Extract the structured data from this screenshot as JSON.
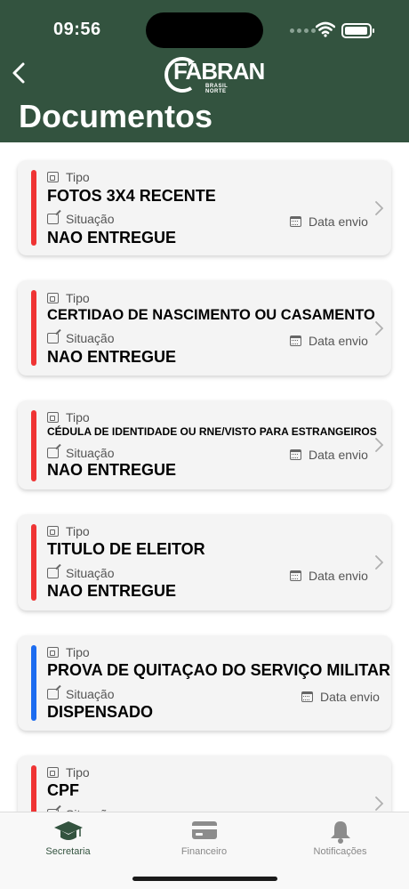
{
  "status_bar": {
    "time": "09:56"
  },
  "header": {
    "logo_text": "FABRAN",
    "logo_subtext": "BRASIL NORTE",
    "title": "Documentos"
  },
  "labels": {
    "tipo": "Tipo",
    "situacao": "Situação",
    "data_envio": "Data envio"
  },
  "documents": [
    {
      "tipo": "FOTOS 3X4 RECENTE",
      "situacao": "NAO ENTREGUE",
      "status_color": "#ef3434"
    },
    {
      "tipo": "CERTIDAO DE NASCIMENTO OU CASAMENTO",
      "situacao": "NAO ENTREGUE",
      "status_color": "#ef3434"
    },
    {
      "tipo": "CÉDULA DE IDENTIDADE OU RNE/VISTO PARA ESTRANGEIROS",
      "situacao": "NAO ENTREGUE",
      "status_color": "#ef3434"
    },
    {
      "tipo": "TITULO DE ELEITOR",
      "situacao": "NAO ENTREGUE",
      "status_color": "#ef3434"
    },
    {
      "tipo": "PROVA DE QUITAÇAO DO SERVIÇO MILITAR",
      "situacao": "DISPENSADO",
      "status_color": "#1c6cf0"
    },
    {
      "tipo": "CPF",
      "situacao": "",
      "status_color": "#ef3434"
    }
  ],
  "tabbar": {
    "items": [
      {
        "label": "Secretaria",
        "icon": "graduation-cap-icon",
        "active": true
      },
      {
        "label": "Financeiro",
        "icon": "credit-card-icon",
        "active": false
      },
      {
        "label": "Notificações",
        "icon": "bell-icon",
        "active": false
      }
    ]
  },
  "colors": {
    "header_bg": "#33533f",
    "status_red": "#ef3434",
    "status_blue": "#1c6cf0"
  }
}
